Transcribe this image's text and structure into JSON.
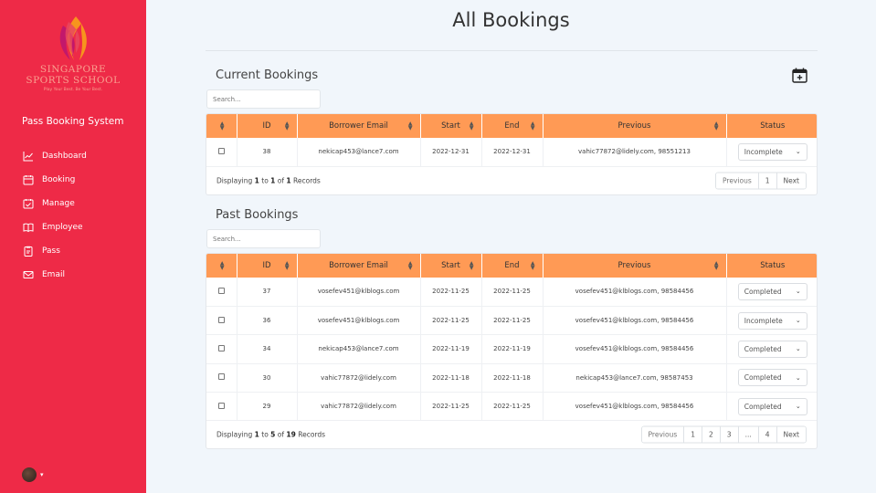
{
  "sidebar": {
    "logo": {
      "line1": "SINGAPORE",
      "line2": "SPORTS SCHOOL",
      "tagline": "Play Your Best. Be Your Best."
    },
    "system_title": "Pass Booking System",
    "items": [
      {
        "label": "Dashboard",
        "icon": "chart-line-icon"
      },
      {
        "label": "Booking",
        "icon": "calendar-icon"
      },
      {
        "label": "Manage",
        "icon": "calendar-check-icon"
      },
      {
        "label": "Employee",
        "icon": "book-open-icon"
      },
      {
        "label": "Pass",
        "icon": "clipboard-icon"
      },
      {
        "label": "Email",
        "icon": "envelope-icon"
      }
    ],
    "avatar_caret": "▾"
  },
  "page": {
    "title": "All Bookings"
  },
  "current": {
    "title": "Current Bookings",
    "search_placeholder": "Search...",
    "columns": [
      "",
      "ID",
      "Borrower Email",
      "Start",
      "End",
      "Previous",
      "Status"
    ],
    "rows": [
      {
        "id": "38",
        "email": "nekicap453@lance7.com",
        "start": "2022-12-31",
        "end": "2022-12-31",
        "previous": "vahic77872@lidely.com, 98551213",
        "status": "Incomplete"
      }
    ],
    "footer": {
      "prefix": "Displaying",
      "from": "1",
      "to_word": "to",
      "to": "1",
      "of_word": "of",
      "total": "1",
      "suffix": "Records"
    },
    "pager": [
      "Previous",
      "1",
      "Next"
    ]
  },
  "past": {
    "title": "Past Bookings",
    "search_placeholder": "Search...",
    "columns": [
      "",
      "ID",
      "Borrower Email",
      "Start",
      "End",
      "Previous",
      "Status"
    ],
    "rows": [
      {
        "id": "37",
        "email": "vosefev451@klblogs.com",
        "start": "2022-11-25",
        "end": "2022-11-25",
        "previous": "vosefev451@klblogs.com, 98584456",
        "status": "Completed"
      },
      {
        "id": "36",
        "email": "vosefev451@klblogs.com",
        "start": "2022-11-25",
        "end": "2022-11-25",
        "previous": "vosefev451@klblogs.com, 98584456",
        "status": "Incomplete"
      },
      {
        "id": "34",
        "email": "nekicap453@lance7.com",
        "start": "2022-11-19",
        "end": "2022-11-19",
        "previous": "vosefev451@klblogs.com, 98584456",
        "status": "Completed"
      },
      {
        "id": "30",
        "email": "vahic77872@lidely.com",
        "start": "2022-11-18",
        "end": "2022-11-18",
        "previous": "nekicap453@lance7.com, 98587453",
        "status": "Completed"
      },
      {
        "id": "29",
        "email": "vahic77872@lidely.com",
        "start": "2022-11-25",
        "end": "2022-11-25",
        "previous": "vosefev451@klblogs.com, 98584456",
        "status": "Completed"
      }
    ],
    "footer": {
      "prefix": "Displaying",
      "from": "1",
      "to_word": "to",
      "to": "5",
      "of_word": "of",
      "total": "19",
      "suffix": "Records"
    },
    "pager": [
      "Previous",
      "1",
      "2",
      "3",
      "...",
      "4",
      "Next"
    ]
  },
  "colors": {
    "sidebar": "#ee2a47",
    "table_header": "#ff9a55",
    "background": "#f1f6fb"
  },
  "icons": {
    "add_booking": "calendar-plus-icon",
    "sort": "sort-icon",
    "status_chevron": "chevron-down-icon"
  }
}
